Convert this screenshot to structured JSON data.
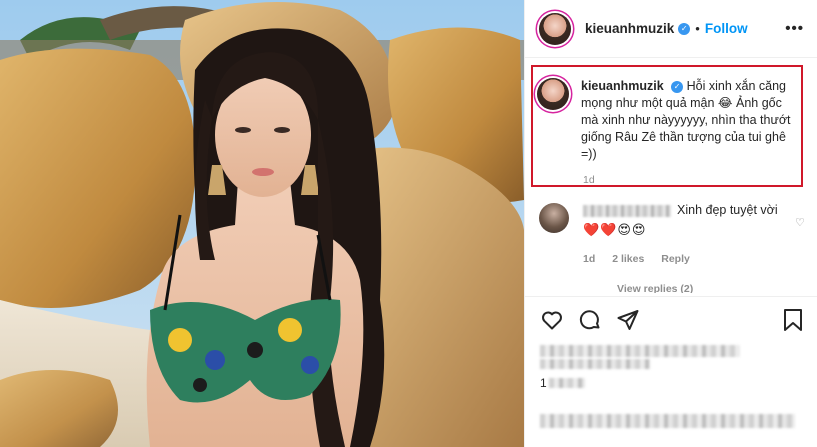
{
  "post": {
    "image_alt": "photo",
    "username": "kieuanhmuzik",
    "follow_label": "Follow",
    "more_label": "•••",
    "separator": "•"
  },
  "caption": {
    "username": "kieuanhmuzik",
    "text": "Hỗi xinh xắn căng mọng như một quả mận 😂 Ảnh gốc mà xinh như nàyyyyyy, nhìn tha thướt giống Râu Zê thần tượng của tui ghê =))",
    "time": "1d"
  },
  "comment": {
    "text": "Xinh đẹp tuyệt vời",
    "emojis": "❤️❤️😍😍",
    "time": "1d",
    "likes": "2 likes",
    "reply_label": "Reply",
    "view_replies": "View replies (2)"
  },
  "likes": {
    "prefix": "1"
  },
  "colors": {
    "accent": "#0095f6",
    "highlight_border": "#d0182a",
    "verified": "#3897f0"
  },
  "icons": [
    "heart-icon",
    "comment-icon",
    "share-icon",
    "bookmark-icon",
    "verified-badge-icon",
    "more-icon"
  ]
}
